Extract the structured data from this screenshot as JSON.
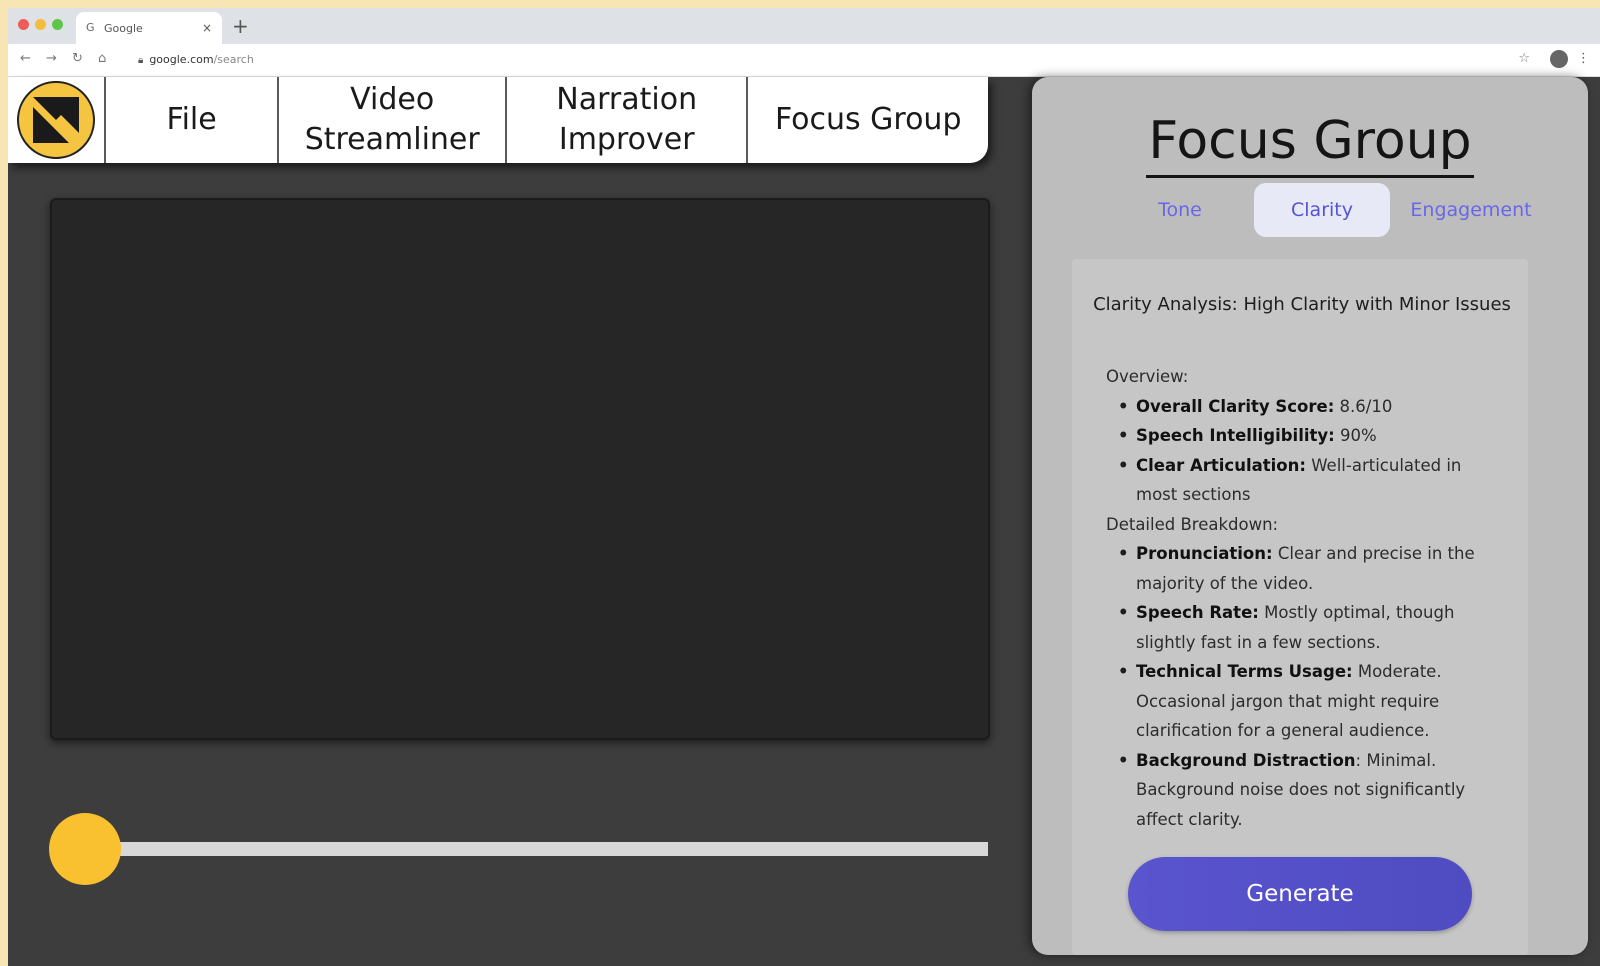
{
  "browser": {
    "tab_title": "Google",
    "url_host": "google.com",
    "url_path": "/search",
    "traffic_colors": [
      "#ee5d55",
      "#f4bd3a",
      "#5ec54a"
    ]
  },
  "menu": {
    "file": "File",
    "video_streamliner": "Video\nStreamliner",
    "narration_improver": "Narration\nImprover",
    "focus_group": "Focus Group"
  },
  "player": {
    "progress_fraction": 0.0,
    "knob_color": "#f9c02f"
  },
  "panel": {
    "title": "Focus Group",
    "tabs": [
      {
        "label": "Tone",
        "active": false
      },
      {
        "label": "Clarity",
        "active": true
      },
      {
        "label": "Engagement",
        "active": false
      }
    ],
    "analysis": {
      "title": "Clarity Analysis: High Clarity with Minor Issues",
      "overview_heading": "Overview:",
      "overview": [
        {
          "label": "Overall Clarity Score:",
          "text": " 8.6/10"
        },
        {
          "label": "Speech Intelligibility:",
          "text": " 90%"
        },
        {
          "label": "Clear Articulation:",
          "text": " Well-articulated in most sections"
        }
      ],
      "breakdown_heading": "Detailed Breakdown:",
      "breakdown": [
        {
          "label": "Pronunciation:",
          "text": " Clear and precise in the majority of the video."
        },
        {
          "label": "Speech Rate:",
          "text": " Mostly optimal, though slightly fast in a few sections."
        },
        {
          "label": "Technical Terms Usage:",
          "text": " Moderate. Occasional jargon that might require clarification for a general audience."
        },
        {
          "label": "Background Distraction",
          "text": ": Minimal. Background noise does not significantly affect clarity."
        }
      ]
    },
    "generate_label": "Generate",
    "accent_color": "#5a55cf"
  }
}
